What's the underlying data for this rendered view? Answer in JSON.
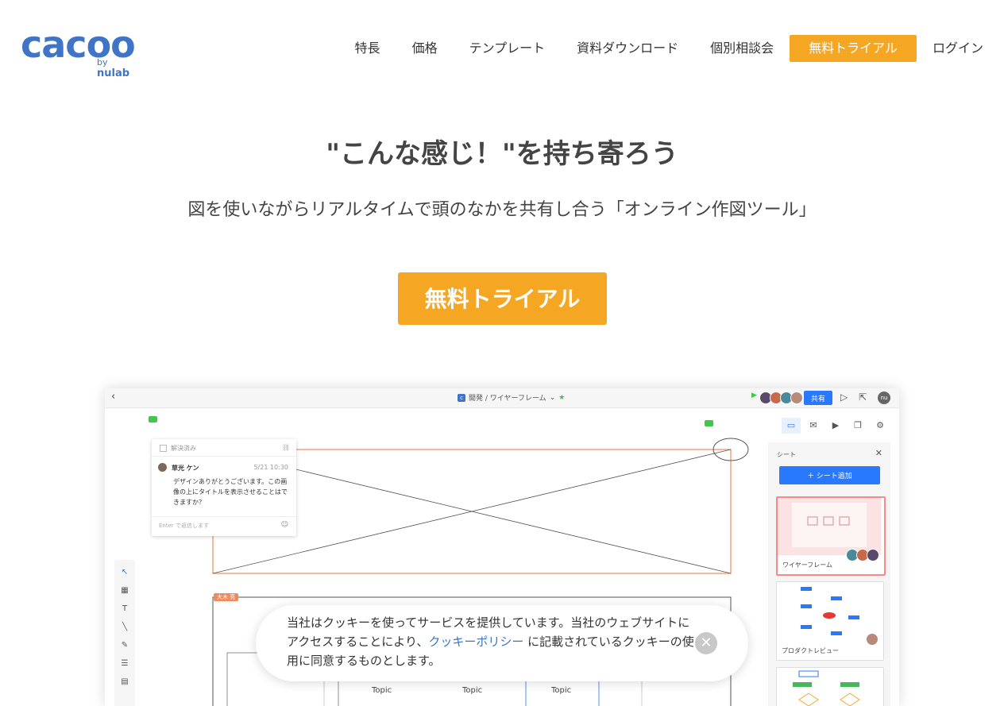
{
  "header": {
    "logo_text": "cacoo",
    "logo_by": "by",
    "logo_company": "nulab",
    "nav": [
      "特長",
      "価格",
      "テンプレート",
      "資料ダウンロード",
      "個別相談会"
    ],
    "nav_cta": "無料トライアル",
    "login": "ログイン"
  },
  "hero": {
    "title": "\"こんな感じ！\"を持ち寄ろう",
    "subtitle": "図を使いながらリアルタイムで頭のなかを共有し合う「オンライン作図ツール」",
    "cta": "無料トライアル"
  },
  "app": {
    "breadcrumb": "開発 / ワイヤーフレーム",
    "share_label": "共有",
    "user_initials": "nu",
    "comment": {
      "resolved_label": "解決済み",
      "author": "草光 ケン",
      "time": "5/21 10:30",
      "body": "デザインありがとうございます。この画像の上にタイトルを表示させることはできますか？",
      "reply_placeholder": "Enter で返信します"
    },
    "cursor_label": "大木 亮",
    "sheet_panel": {
      "title": "シート",
      "add_label": "＋ シート追加",
      "sheets": [
        "ワイヤーフレーム",
        "プロダクトレビュー"
      ]
    },
    "topics": [
      "Topic",
      "Topic",
      "Topic"
    ]
  },
  "cookie": {
    "text_before": "当社はクッキーを使ってサービスを提供しています。当社のウェブサイトにアクセスすることにより、",
    "link_text": "クッキーポリシー",
    "text_after": " に記載されているクッキーの使用に同意するものとします。"
  },
  "colors": {
    "brand_blue": "#3f74c6",
    "cta_orange": "#f5a623",
    "app_blue": "#2979ff",
    "wire_orange": "#f08a5d"
  }
}
